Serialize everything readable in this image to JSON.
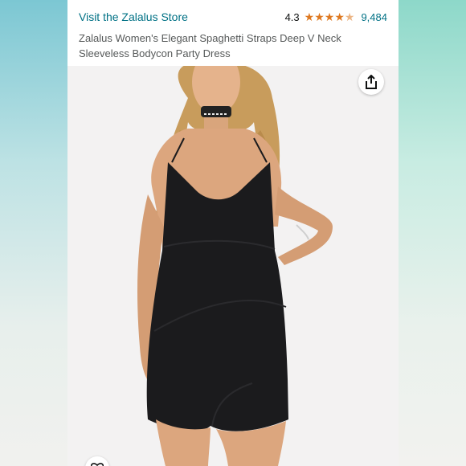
{
  "store": {
    "link_label": "Visit the Zalalus Store"
  },
  "rating": {
    "value": "4.3",
    "stars_filled": 4.3,
    "review_count": "9,484"
  },
  "product": {
    "title": "Zalalus Women's Elegant Spaghetti Straps Deep V Neck Sleeveless Bodycon Party Dress"
  },
  "colors": {
    "link": "#007185",
    "star": "#de7921",
    "dress": "#1b1b1d"
  },
  "icons": {
    "share": "share-icon",
    "heart": "heart-icon"
  }
}
